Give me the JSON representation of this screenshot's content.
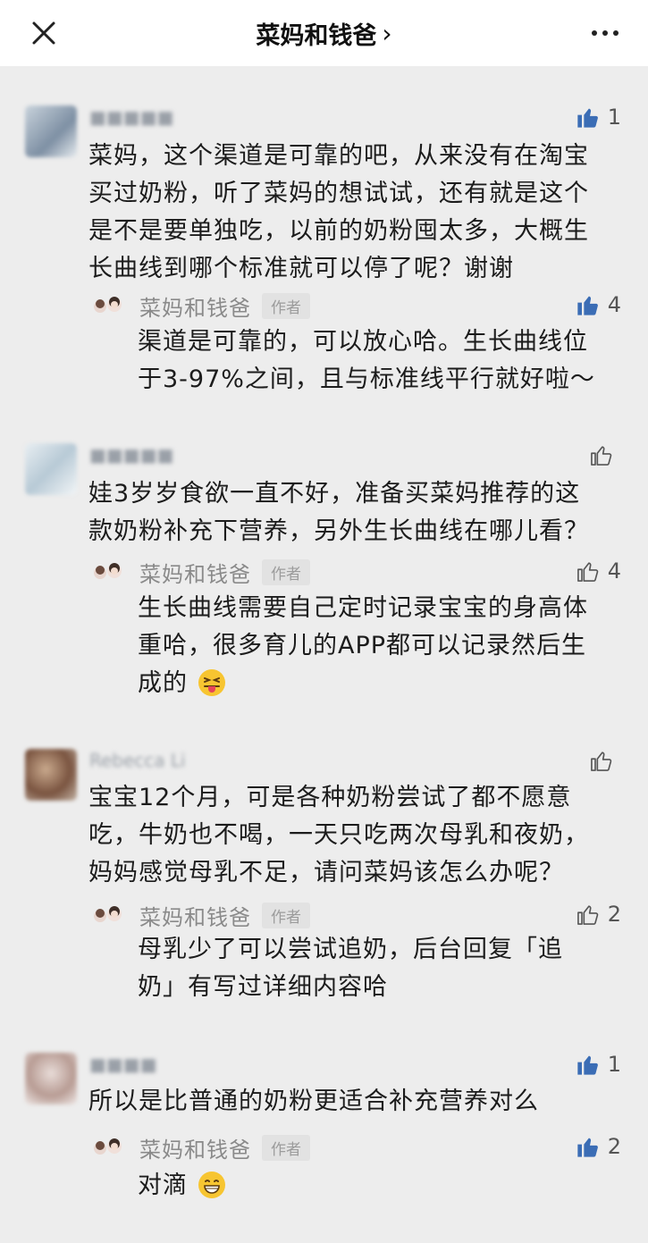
{
  "header": {
    "title": "菜妈和钱爸",
    "chevron": "›",
    "close_icon": "close-icon",
    "more_icon": "more-icon"
  },
  "author_badge": "作者",
  "comments": [
    {
      "avatar_color": "#9fb4c8",
      "likes": "1",
      "liked": true,
      "text_lines": [
        "菜妈，这个渠道是可靠的吧，从来没有在淘宝",
        "买过奶粉，听了菜妈的想试试，还有就是这个",
        "是不是要单独吃，以前的奶粉囤太多，大概生",
        "长曲线到哪个标准就可以停了呢？谢谢"
      ],
      "reply": {
        "name": "菜妈和钱爸",
        "likes": "4",
        "liked": true,
        "text_lines": [
          "渠道是可靠的，可以放心哈。生长曲线位",
          "于3-97%之间，且与标准线平行就好啦～"
        ]
      }
    },
    {
      "avatar_color": "#c9d6df",
      "likes": "",
      "liked": false,
      "text_lines": [
        "娃3岁岁食欲一直不好，准备买菜妈推荐的这",
        "款奶粉补充下营养，另外生长曲线在哪儿看？"
      ],
      "reply": {
        "name": "菜妈和钱爸",
        "likes": "4",
        "liked": false,
        "text_lines": [
          "生长曲线需要自己定时记录宝宝的身高体",
          "重哈，很多育儿的APP都可以记录然后生",
          "成的"
        ],
        "emoji": "tongue-out-emoji"
      }
    },
    {
      "avatar_color": "#8a6a55",
      "nickname": "Rebecca Li",
      "likes": "",
      "liked": false,
      "text_lines": [
        "宝宝12个月，可是各种奶粉尝试了都不愿意",
        "吃，牛奶也不喝，一天只吃两次母乳和夜奶，",
        "妈妈感觉母乳不足，请问菜妈该怎么办呢？"
      ],
      "reply": {
        "name": "菜妈和钱爸",
        "likes": "2",
        "liked": false,
        "text_lines": [
          "母乳少了可以尝试追奶，后台回复「追",
          "奶」有写过详细内容哈"
        ]
      }
    },
    {
      "avatar_color": "#d9c9c4",
      "likes": "1",
      "liked": true,
      "text_lines": [
        "所以是比普通的奶粉更适合补充营养对么"
      ],
      "reply": {
        "name": "菜妈和钱爸",
        "likes": "2",
        "liked": true,
        "text_lines": [
          "对滴"
        ],
        "emoji": "grin-emoji"
      }
    }
  ]
}
